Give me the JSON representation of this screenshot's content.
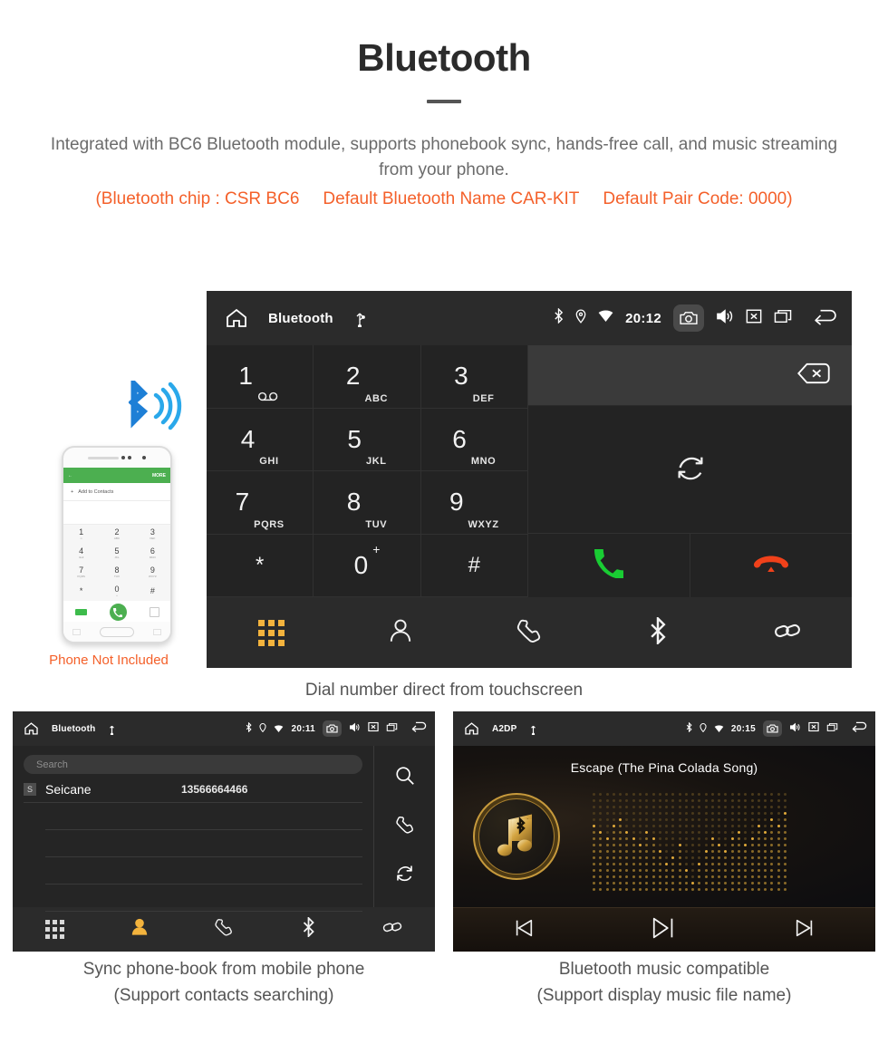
{
  "header": {
    "title": "Bluetooth",
    "intro": "Integrated with BC6 Bluetooth module, supports phonebook sync, hands-free call, and music streaming from your phone.",
    "spec_chip": "(Bluetooth chip : CSR BC6",
    "spec_name": "Default Bluetooth Name CAR-KIT",
    "spec_code": "Default Pair Code: 0000)",
    "accent_color": "#f4602a",
    "text_color": "#6b6b6b"
  },
  "phone_mockup": {
    "caption": "Phone Not Included",
    "screen": {
      "back_label": "←",
      "more_label": "MORE",
      "add_to_contacts": "Add to Contacts",
      "plus": "+",
      "keys": [
        {
          "num": "1",
          "sub": "∞"
        },
        {
          "num": "2",
          "sub": "ABC"
        },
        {
          "num": "3",
          "sub": "DEF"
        },
        {
          "num": "4",
          "sub": "GHI"
        },
        {
          "num": "5",
          "sub": "JKL"
        },
        {
          "num": "6",
          "sub": "MNO"
        },
        {
          "num": "7",
          "sub": "PQRS"
        },
        {
          "num": "8",
          "sub": "TUV"
        },
        {
          "num": "9",
          "sub": "WXYZ"
        },
        {
          "num": "*",
          "sub": ""
        },
        {
          "num": "0",
          "sub": "+"
        },
        {
          "num": "#",
          "sub": ""
        }
      ]
    }
  },
  "dialer": {
    "statusbar": {
      "title": "Bluetooth",
      "time": "20:12",
      "icons": [
        "home-icon",
        "usb-icon",
        "bluetooth-icon",
        "location-icon",
        "wifi-icon",
        "camera-icon",
        "volume-icon",
        "close-box-icon",
        "recent-apps-icon",
        "back-icon"
      ]
    },
    "keys": [
      {
        "num": "1",
        "sub": "voicemail"
      },
      {
        "num": "2",
        "sub": "ABC"
      },
      {
        "num": "3",
        "sub": "DEF"
      },
      {
        "num": "4",
        "sub": "GHI"
      },
      {
        "num": "5",
        "sub": "JKL"
      },
      {
        "num": "6",
        "sub": "MNO"
      },
      {
        "num": "7",
        "sub": "PQRS"
      },
      {
        "num": "8",
        "sub": "TUV"
      },
      {
        "num": "9",
        "sub": "WXYZ"
      },
      {
        "num": "*",
        "sub": ""
      },
      {
        "num": "0",
        "sub": "+"
      },
      {
        "num": "#",
        "sub": ""
      }
    ],
    "number_input_value": "",
    "actions": {
      "backspace": "backspace-icon",
      "redial": "redial-icon",
      "call": "call-icon",
      "hangup": "hangup-icon",
      "call_color": "#19cc33",
      "hangup_color": "#f0411a"
    },
    "tabs": [
      {
        "name": "keypad",
        "icon": "keypad-icon",
        "active": true
      },
      {
        "name": "contacts",
        "icon": "contacts-icon",
        "active": false
      },
      {
        "name": "call-log",
        "icon": "phone-icon",
        "active": false
      },
      {
        "name": "bluetooth",
        "icon": "bluetooth-icon",
        "active": false
      },
      {
        "name": "pair",
        "icon": "link-icon",
        "active": false
      }
    ],
    "active_color": "#f3b33d",
    "caption": "Dial number direct from touchscreen"
  },
  "contacts_screen": {
    "statusbar": {
      "title": "Bluetooth",
      "time": "20:11"
    },
    "search_placeholder": "Search",
    "contacts": [
      {
        "badge": "S",
        "name": "Seicane",
        "number": "13566664466"
      }
    ],
    "empty_rows": 4,
    "side_icons": [
      "search-icon",
      "phone-icon",
      "sync-icon"
    ],
    "tabs": [
      {
        "name": "keypad",
        "icon": "keypad-icon",
        "active": false
      },
      {
        "name": "contacts",
        "icon": "contacts-icon",
        "active": true
      },
      {
        "name": "call-log",
        "icon": "phone-icon",
        "active": false
      },
      {
        "name": "bluetooth",
        "icon": "bluetooth-icon",
        "active": false
      },
      {
        "name": "pair",
        "icon": "link-icon",
        "active": false
      }
    ],
    "caption_line1": "Sync phone-book from mobile phone",
    "caption_line2": "(Support contacts searching)"
  },
  "music_screen": {
    "statusbar": {
      "title": "A2DP",
      "time": "20:15"
    },
    "song_title": "Escape (The Pina Colada Song)",
    "controls": [
      {
        "name": "previous",
        "icon": "previous-track-icon"
      },
      {
        "name": "play-pause",
        "icon": "play-pause-icon"
      },
      {
        "name": "next",
        "icon": "next-track-icon"
      }
    ],
    "accent_color": "#e0a93a",
    "caption_line1": "Bluetooth music compatible",
    "caption_line2": "(Support display music file name)"
  }
}
